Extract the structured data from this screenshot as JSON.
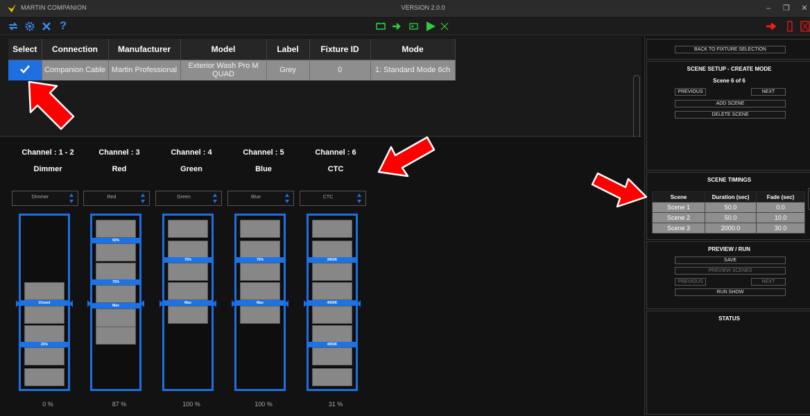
{
  "app": {
    "title": "MARTIN COMPANION",
    "version": "VERSION 2.0.0"
  },
  "colors": {
    "accent": "#1a73e8",
    "fader_border": "#1f6fe0",
    "cell": "#8e8e8e",
    "arrow": "#ff0000",
    "play": "#2ecc40"
  },
  "toolbar_left": [
    "swap-icon",
    "gear-icon",
    "tools-icon",
    "help-icon"
  ],
  "toolbar_center": [
    "fixture-icon",
    "forward-icon",
    "dmx-icon",
    "play-icon",
    "cancel-icon"
  ],
  "toolbar_right": [
    "export-icon",
    "device-icon",
    "close-red-icon"
  ],
  "fixture_table": {
    "headers": [
      "Select",
      "Connection",
      "Manufacturer",
      "Model",
      "Label",
      "Fixture ID",
      "Mode"
    ],
    "rows": [
      {
        "selected": true,
        "connection": "Companion Cable",
        "manufacturer": "Martin Professional",
        "model": "Exterior Wash Pro M QUAD",
        "label": "Grey",
        "fixture_id": "0",
        "mode": "1: Standard Mode 6ch"
      }
    ]
  },
  "channels": [
    {
      "num": "Channel : 1 - 2",
      "name": "Dimmer",
      "select": "Dimmer",
      "labels": [
        "Closed",
        "25%"
      ],
      "value": "0 %"
    },
    {
      "num": "Channel : 3",
      "name": "Red",
      "select": "Red",
      "labels": [
        "50%",
        "75%",
        "Max"
      ],
      "value": "87 %"
    },
    {
      "num": "Channel : 4",
      "name": "Green",
      "select": "Green",
      "labels": [
        "75%",
        "Max"
      ],
      "value": "100 %"
    },
    {
      "num": "Channel : 5",
      "name": "Blue",
      "select": "Blue",
      "labels": [
        "75%",
        "Max"
      ],
      "value": "100 %"
    },
    {
      "num": "Channel : 6",
      "name": "CTC",
      "select": "CTC",
      "labels": [
        "3950K",
        "4000K",
        "4050K"
      ],
      "value": "31 %"
    }
  ],
  "right_panel": {
    "back": "BACK TO FIXTURE SELECTION",
    "scene_setup": {
      "title": "SCENE SETUP - CREATE MODE",
      "scene_count": "Scene 6 of 6",
      "previous": "PREVIOUS",
      "next": "NEXT",
      "add": "ADD SCENE",
      "delete": "DELETE SCENE"
    },
    "timings": {
      "title": "SCENE TIMINGS",
      "headers": [
        "Scene",
        "Duration (sec)",
        "Fade (sec)"
      ],
      "rows": [
        [
          "Scene 1",
          "50.0",
          "0.0"
        ],
        [
          "Scene 2",
          "50.0",
          "10.0"
        ],
        [
          "Scene 3",
          "2000.0",
          "30.0"
        ]
      ]
    },
    "preview": {
      "title": "PREVIEW / RUN",
      "save": "SAVE",
      "preview_scenes": "PREVIEW SCENES",
      "previous": "PREVIOUS",
      "next": "NEXT",
      "run": "RUN SHOW"
    },
    "status": {
      "title": "STATUS"
    }
  }
}
